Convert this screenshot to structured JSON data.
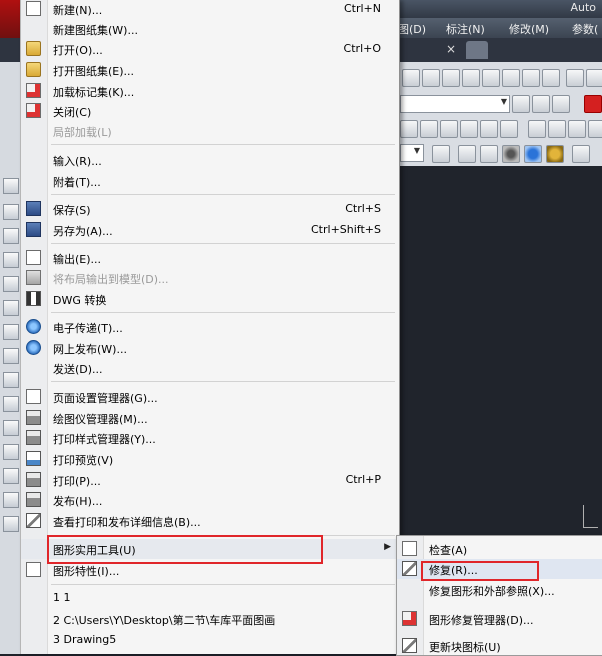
{
  "background": {
    "app_title": "Auto",
    "menus": [
      "图(D)",
      "标注(N)",
      "修改(M)",
      "参数("
    ],
    "tab_close": "×",
    "combo_arrow": "▼"
  },
  "file_menu": {
    "items": [
      {
        "label": "新建(N)...",
        "shortcut": "Ctrl+N",
        "icon": "new-file-icon"
      },
      {
        "label": "新建图纸集(W)...",
        "shortcut": "",
        "icon": ""
      },
      {
        "label": "打开(O)...",
        "shortcut": "Ctrl+O",
        "icon": "open-folder-icon"
      },
      {
        "label": "打开图纸集(E)...",
        "shortcut": "",
        "icon": "open-sheet-set-icon"
      },
      {
        "label": "加载标记集(K)...",
        "shortcut": "",
        "icon": "markup-set-icon"
      },
      {
        "label": "关闭(C)",
        "shortcut": "",
        "icon": "close-file-icon"
      },
      {
        "label": "局部加载(L)",
        "shortcut": "",
        "icon": "",
        "disabled": true
      },
      {
        "label": "输入(R)...",
        "shortcut": "",
        "icon": ""
      },
      {
        "label": "附着(T)...",
        "shortcut": "",
        "icon": ""
      },
      {
        "label": "保存(S)",
        "shortcut": "Ctrl+S",
        "icon": "save-disk-icon"
      },
      {
        "label": "另存为(A)...",
        "shortcut": "Ctrl+Shift+S",
        "icon": "save-as-icon"
      },
      {
        "label": "输出(E)...",
        "shortcut": "",
        "icon": "export-icon"
      },
      {
        "label": "将布局输出到模型(D)...",
        "shortcut": "",
        "icon": "layout-to-model-icon",
        "disabled": true
      },
      {
        "label": "DWG 转换",
        "shortcut": "",
        "icon": "dwg-convert-icon"
      },
      {
        "label": "电子传递(T)...",
        "shortcut": "",
        "icon": "etransmit-icon"
      },
      {
        "label": "网上发布(W)...",
        "shortcut": "",
        "icon": "publish-web-icon"
      },
      {
        "label": "发送(D)...",
        "shortcut": "",
        "icon": ""
      },
      {
        "label": "页面设置管理器(G)...",
        "shortcut": "",
        "icon": "page-setup-icon"
      },
      {
        "label": "绘图仪管理器(M)...",
        "shortcut": "",
        "icon": "plotter-manager-icon"
      },
      {
        "label": "打印样式管理器(Y)...",
        "shortcut": "",
        "icon": "plot-style-icon"
      },
      {
        "label": "打印预览(V)",
        "shortcut": "",
        "icon": "plot-preview-icon"
      },
      {
        "label": "打印(P)...",
        "shortcut": "Ctrl+P",
        "icon": "printer-icon"
      },
      {
        "label": "发布(H)...",
        "shortcut": "",
        "icon": "publish-icon"
      },
      {
        "label": "查看打印和发布详细信息(B)...",
        "shortcut": "",
        "icon": "plot-details-icon"
      },
      {
        "label": "图形实用工具(U)",
        "shortcut": "",
        "icon": "",
        "submenu": true
      },
      {
        "label": "图形特性(I)...",
        "shortcut": "",
        "icon": "drawing-properties-icon"
      },
      {
        "label": "1 1",
        "shortcut": "",
        "icon": ""
      },
      {
        "label": "2 C:\\Users\\Y\\Desktop\\第二节\\车库平面图画",
        "shortcut": "",
        "icon": ""
      },
      {
        "label": "3 Drawing5",
        "shortcut": "",
        "icon": ""
      }
    ],
    "submenu_arrow": "▶"
  },
  "sub_menu": {
    "items": [
      {
        "label": "检查(A)",
        "icon": "audit-icon"
      },
      {
        "label": "修复(R)...",
        "icon": "recover-icon"
      },
      {
        "label": "修复图形和外部参照(X)...",
        "icon": ""
      },
      {
        "label": "图形修复管理器(D)...",
        "icon": "drawing-recovery-icon"
      },
      {
        "label": "更新块图标(U)",
        "icon": "update-block-icon"
      }
    ]
  },
  "colors": {
    "highlight_box": "#e0262a",
    "menu_bg": "#f5f5f5",
    "app_dark": "#1e222a"
  }
}
